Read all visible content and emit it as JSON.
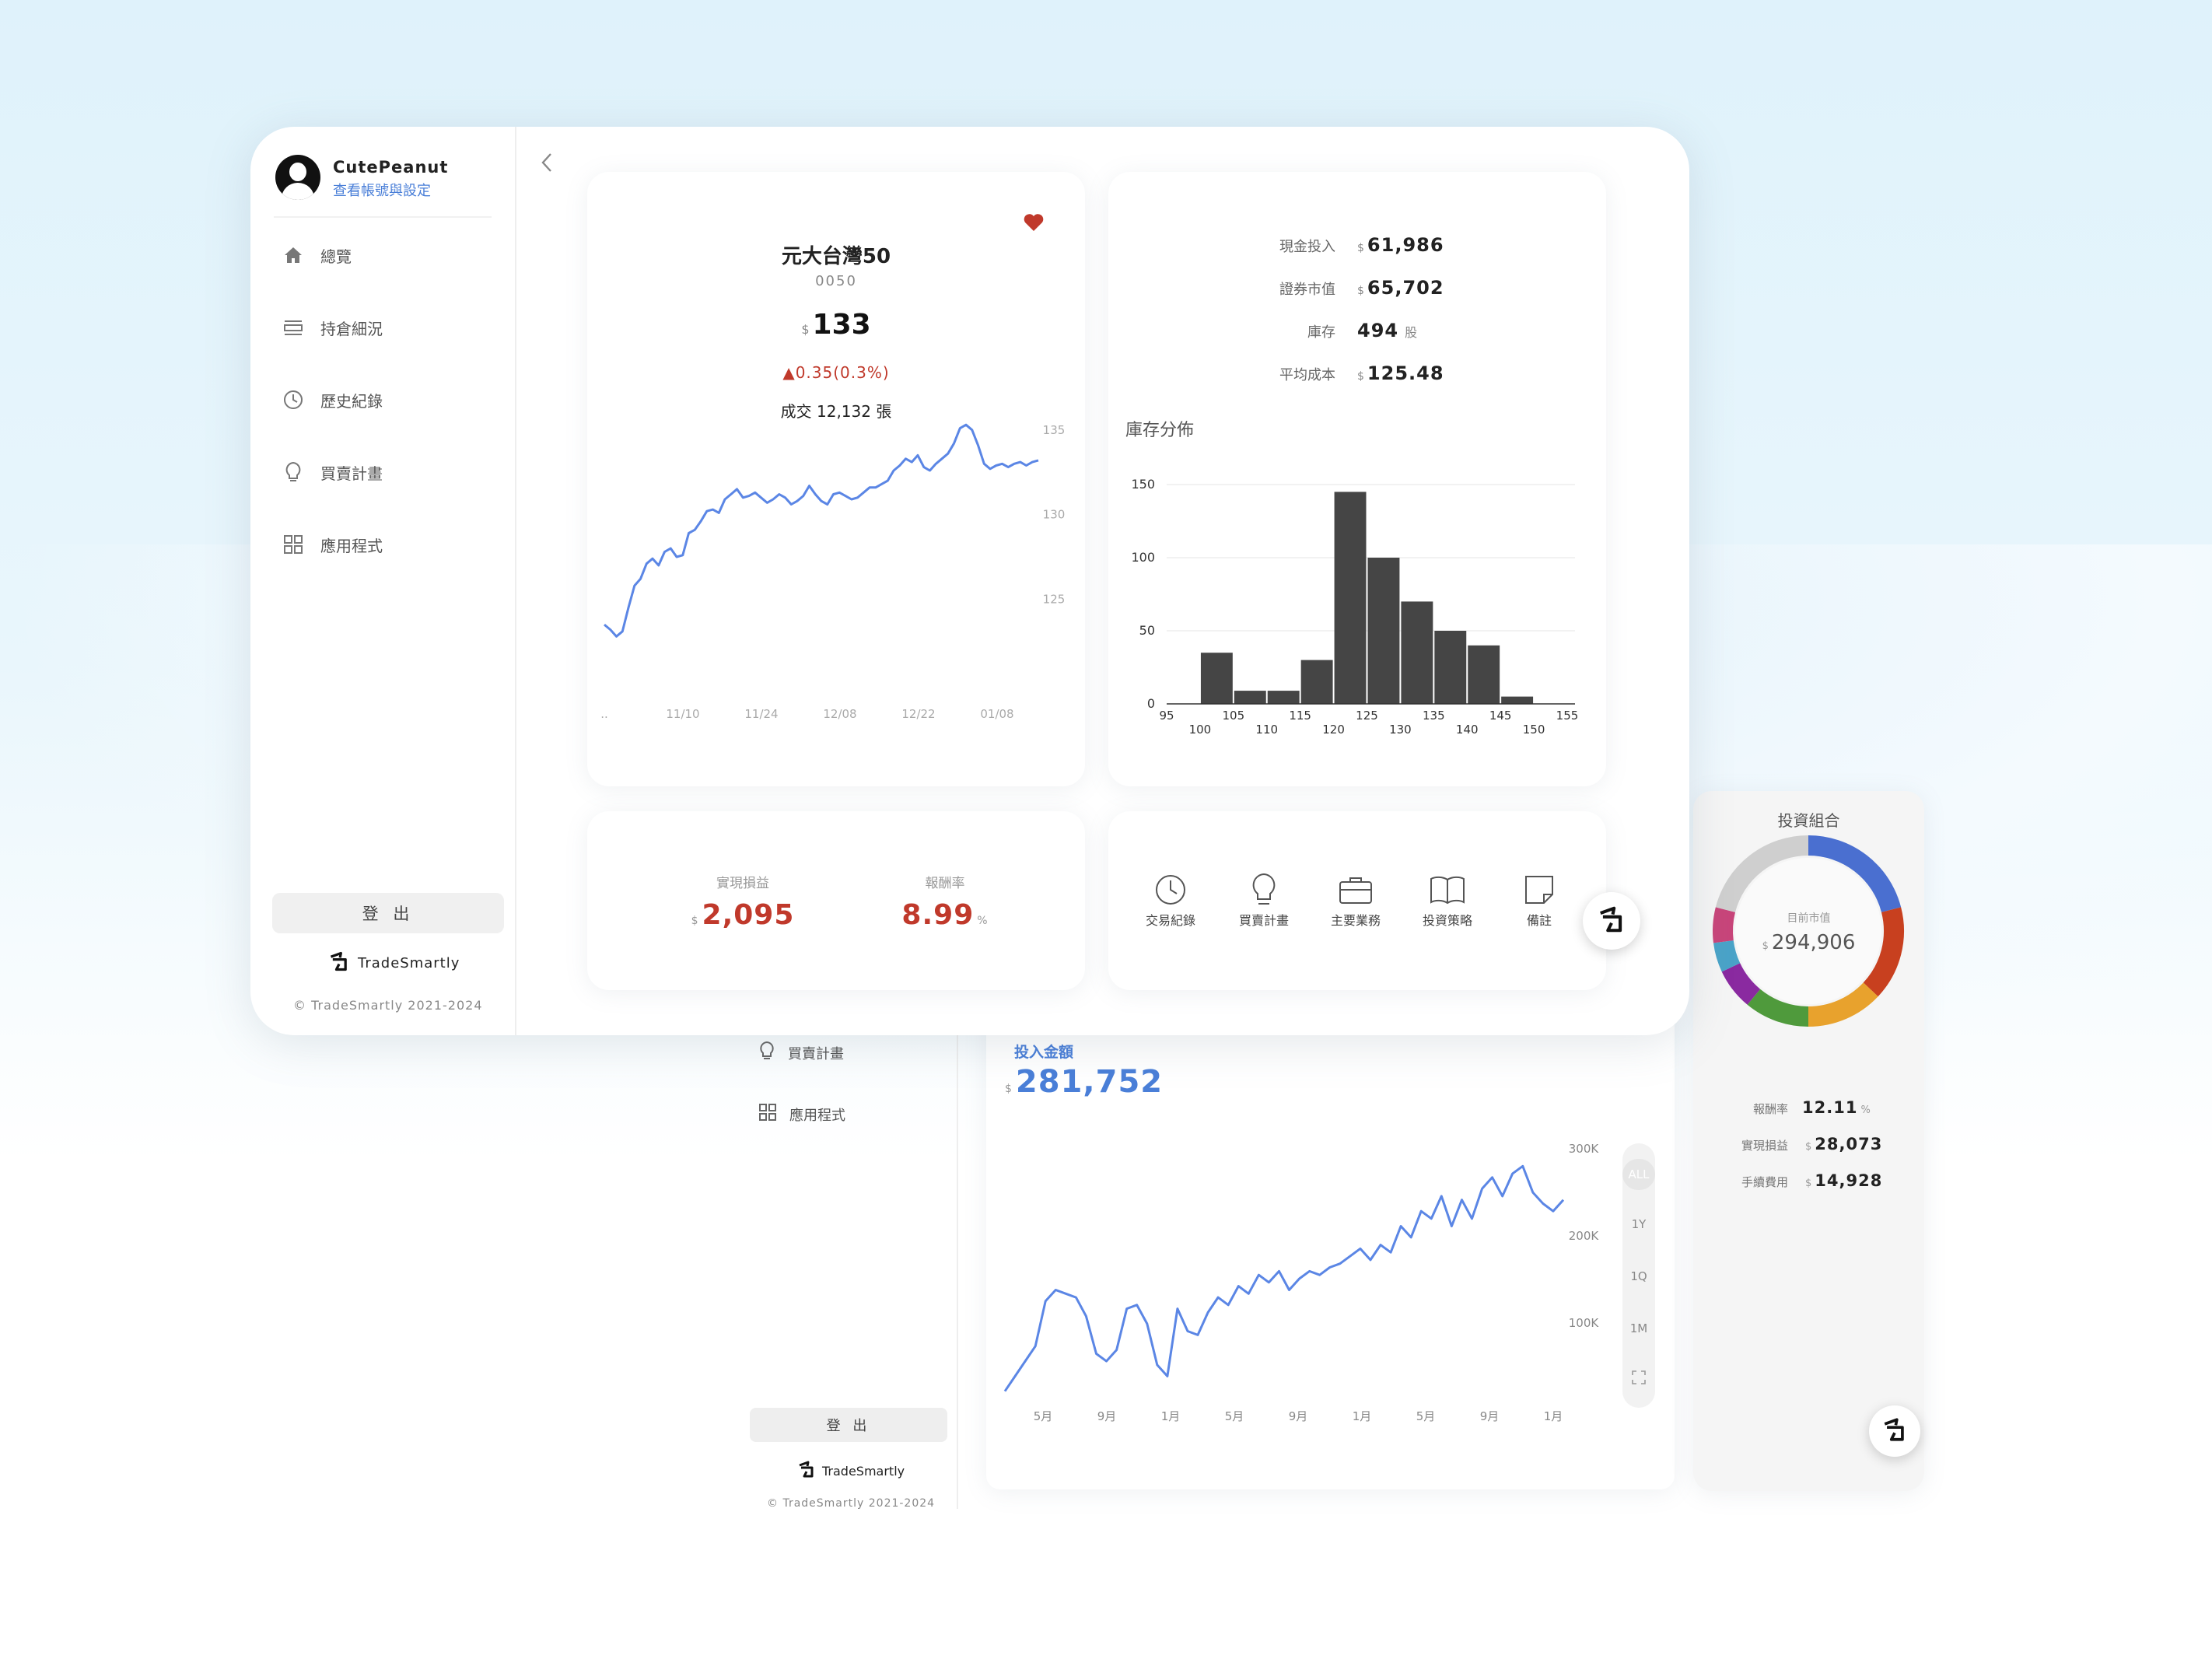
{
  "user": {
    "name": "CutePeanut",
    "account_link": "查看帳號與設定"
  },
  "sidebar": {
    "items": [
      {
        "label": "總覽",
        "icon": "home-icon"
      },
      {
        "label": "持倉細況",
        "icon": "list-icon"
      },
      {
        "label": "歷史紀錄",
        "icon": "clock-icon"
      },
      {
        "label": "買賣計畫",
        "icon": "lightbulb-icon"
      },
      {
        "label": "應用程式",
        "icon": "grid-icon"
      }
    ],
    "logout_label": "登 出",
    "brand": "TradeSmartly",
    "copyright": "© TradeSmartly 2021-2024"
  },
  "stock": {
    "name": "元大台灣50",
    "code": "0050",
    "currency": "$",
    "price": "133",
    "change": "▲0.35(0.3%)",
    "volume": "成交 12,132 張",
    "favorite": true,
    "accent_up": "#c0392b",
    "line_color": "#5b86e5"
  },
  "stock_chart": {
    "type": "line",
    "x_ticks": [
      "..",
      "11/10",
      "11/24",
      "12/08",
      "12/22",
      "01/08"
    ],
    "y_ticks": [
      "135",
      "130",
      "125"
    ],
    "ylim": [
      119,
      136
    ],
    "values": [
      123.5,
      123.2,
      122.8,
      123.1,
      124.5,
      125.8,
      126.2,
      127.1,
      127.4,
      127.0,
      127.8,
      128.0,
      127.5,
      127.6,
      128.9,
      129.1,
      129.6,
      130.2,
      130.3,
      130.1,
      130.9,
      131.2,
      131.5,
      131.0,
      131.1,
      131.3,
      131.0,
      130.7,
      130.9,
      131.2,
      131.0,
      130.6,
      130.8,
      131.1,
      131.7,
      131.2,
      130.8,
      130.6,
      131.2,
      131.3,
      131.1,
      130.9,
      131.0,
      131.3,
      131.6,
      131.6,
      131.8,
      132.0,
      132.6,
      132.9,
      133.3,
      133.1,
      133.5,
      132.8,
      132.6,
      133.0,
      133.3,
      133.6,
      134.2,
      135.1,
      135.3,
      135.0,
      134.1,
      133.0,
      132.7,
      132.9,
      133.0,
      132.8,
      133.0,
      133.1,
      132.9,
      133.1,
      133.2
    ]
  },
  "holdings": {
    "rows": [
      {
        "label": "現金投入",
        "currency": "$",
        "value": "61,986",
        "unit": ""
      },
      {
        "label": "證券市值",
        "currency": "$",
        "value": "65,702",
        "unit": ""
      },
      {
        "label": "庫存",
        "currency": "",
        "value": "494",
        "unit": "股"
      },
      {
        "label": "平均成本",
        "currency": "$",
        "value": "125.48",
        "unit": ""
      }
    ],
    "distribution_title": "庫存分佈"
  },
  "histogram": {
    "type": "bar",
    "bar_color": "#454545",
    "categories": [
      "95-100",
      "100-105",
      "105-110",
      "110-115",
      "115-120",
      "120-125",
      "125-130",
      "130-135",
      "135-140",
      "140-145",
      "145-150",
      "150-155"
    ],
    "values": [
      0,
      35,
      9,
      9,
      30,
      145,
      100,
      70,
      50,
      40,
      5,
      0
    ],
    "ylim": [
      0,
      150
    ],
    "y_ticks": [
      "0",
      "50",
      "100",
      "150"
    ],
    "x_ticks_top": [
      "95",
      "105",
      "115",
      "125",
      "135",
      "145",
      "155"
    ],
    "x_ticks_bottom": [
      "100",
      "110",
      "120",
      "130",
      "140",
      "150"
    ]
  },
  "pnl": {
    "realized_label": "實現損益",
    "realized_currency": "$",
    "realized_value": "2,095",
    "return_label": "報酬率",
    "return_value": "8.99",
    "return_unit": "%"
  },
  "apps": [
    {
      "label": "交易紀錄",
      "icon": "clock-icon"
    },
    {
      "label": "買賣計畫",
      "icon": "lightbulb-icon"
    },
    {
      "label": "主要業務",
      "icon": "briefcase-icon"
    },
    {
      "label": "投資策略",
      "icon": "book-icon"
    },
    {
      "label": "備註",
      "icon": "note-icon"
    }
  ],
  "portfolio": {
    "title": "投資組合",
    "center_label": "目前市值",
    "currency": "$",
    "center_value": "294,906",
    "slices": [
      {
        "color": "#4a6fd0",
        "value": 21
      },
      {
        "color": "#c8401f",
        "value": 16
      },
      {
        "color": "#e8a22d",
        "value": 13
      },
      {
        "color": "#4f9a3c",
        "value": 11
      },
      {
        "color": "#8a2aa0",
        "value": 7
      },
      {
        "color": "#4aa3c8",
        "value": 5
      },
      {
        "color": "#c8457a",
        "value": 6
      },
      {
        "color": "#cfcfcf",
        "value": 21
      }
    ],
    "rows": [
      {
        "label": "報酬率",
        "currency": "",
        "value": "12.11",
        "unit": "%"
      },
      {
        "label": "實現損益",
        "currency": "$",
        "value": "28,073",
        "unit": ""
      },
      {
        "label": "手續費用",
        "currency": "$",
        "value": "14,928",
        "unit": ""
      }
    ]
  },
  "investment": {
    "label": "投入金額",
    "currency": "$",
    "value": "281,752",
    "x_ticks": [
      "5月",
      "9月",
      "1月",
      "5月",
      "9月",
      "1月",
      "5月",
      "9月",
      "1月"
    ],
    "y_ticks": [
      "300K",
      "200K",
      "100K"
    ],
    "ranges": [
      "ALL",
      "1Y",
      "1Q",
      "1M"
    ],
    "line_color": "#5b86e5"
  },
  "investment_chart": {
    "type": "line",
    "ylim": [
      0,
      340000
    ],
    "values": [
      20000,
      40000,
      60000,
      80000,
      140000,
      155000,
      150000,
      145000,
      120000,
      70000,
      60000,
      75000,
      130000,
      135000,
      110000,
      55000,
      40000,
      130000,
      100000,
      95000,
      125000,
      145000,
      135000,
      160000,
      150000,
      175000,
      165000,
      180000,
      155000,
      170000,
      180000,
      175000,
      185000,
      190000,
      200000,
      210000,
      195000,
      215000,
      205000,
      240000,
      225000,
      260000,
      250000,
      280000,
      240000,
      275000,
      250000,
      290000,
      305000,
      280000,
      310000,
      320000,
      285000,
      270000,
      260000,
      275000
    ]
  },
  "ghost": {
    "nav_plan": "買賣計畫",
    "nav_apps": "應用程式",
    "logout": "登 出",
    "brand": "TradeSmartly",
    "copyright": "© TradeSmartly 2021-2024"
  }
}
